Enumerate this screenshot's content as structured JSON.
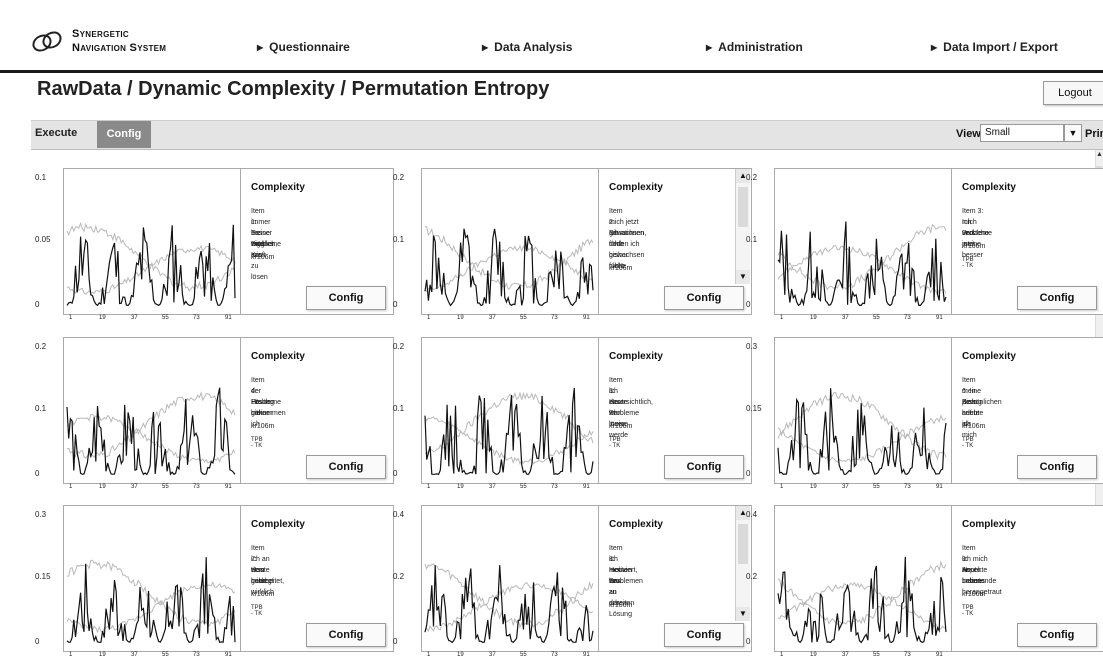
{
  "app": {
    "logo_line1": "Synergetic",
    "logo_line2": "Navigation System"
  },
  "nav": [
    {
      "label": "Questionnaire"
    },
    {
      "label": "Data Analysis"
    },
    {
      "label": "Administration"
    },
    {
      "label": "Data Import / Export"
    }
  ],
  "page_title": "RawData / Dynamic Complexity / Permutation Entropy",
  "logout_label": "Logout",
  "tabs": {
    "execute": "Execute",
    "config": "Config"
  },
  "view": {
    "label": "View",
    "selected": "Small",
    "print_label": "Prin"
  },
  "colors": {
    "accent_tab": "#8a8a8a",
    "line_dark": "#111111",
    "line_light": "#b9b9b9"
  },
  "icons": {
    "logo": "logo-icon",
    "nav_arrow": "triangle-right-icon",
    "dropdown": "chevron-down-icon"
  },
  "panels": [
    {
      "ymax": "0.1",
      "ymid": "0.05",
      "ymin": "0",
      "xticks": [
        "1",
        "19",
        "37",
        "55",
        "73",
        "91"
      ],
      "title": "Complexity",
      "item_lines": [
        "Item 1:   Es wird mir",
        "immer besser möglich,",
        "meine Probleme aus",
        "eigener Kraft zu lösen"
      ],
      "code": "kr106m",
      "tpb": "",
      "button": "Config"
    },
    {
      "ymax": "0.2",
      "ymid": "0.1",
      "ymin": "0",
      "xticks": [
        "1",
        "19",
        "37",
        "55",
        "73",
        "91"
      ],
      "title": "Complexity",
      "item_lines": [
        "Item 2:   Ich fühle",
        "mich jetzt Situationen",
        "gewachsen, denen ich",
        "mich bisher nicht",
        "gewachsen fühlte"
      ],
      "code": "kr106m",
      "tpb": "",
      "button": "Config"
    },
    {
      "ymax": "0.2",
      "ymid": "0.1",
      "ymin": "0",
      "xticks": [
        "1",
        "19",
        "37",
        "55",
        "73",
        "91"
      ],
      "title": "Complexity",
      "item_lines": [
        "Item 3:   Ich verstehe",
        "mich und meine",
        "Probleme jetzt besser"
      ],
      "code": "kr106m",
      "tpb": "TPB - TK",
      "button": "Config"
    },
    {
      "ymax": "0.2",
      "ymid": "0.1",
      "ymin": "0",
      "xticks": [
        "1",
        "19",
        "37",
        "55",
        "73",
        "91"
      ],
      "title": "Complexity",
      "item_lines": [
        "Item 4:   Heute bin ich",
        "der Lösung meiner",
        "Probleme näher",
        "gekommen"
      ],
      "code": "kr106m",
      "tpb": "TPB - TK",
      "button": "Config"
    },
    {
      "ymax": "0.2",
      "ymid": "0.1",
      "ymin": "0",
      "xticks": [
        "1",
        "19",
        "37",
        "55",
        "73",
        "91"
      ],
      "title": "Complexity",
      "item_lines": [
        "Item 5:   Heute war",
        "ich zuversichtlich,",
        "dass ich meine",
        "Probleme lösen werde"
      ],
      "code": "kr106m",
      "tpb": "TPB - TK",
      "button": "Config"
    },
    {
      "ymax": "0.3",
      "ymid": "0.15",
      "ymin": "0",
      "xticks": [
        "1",
        "19",
        "37",
        "55",
        "73",
        "91"
      ],
      "title": "Complexity",
      "item_lines": [
        "Item 6:   In Bezug auf",
        "meine persönlichen",
        "Ziele erlebte ich mich",
        "heute als"
      ],
      "code": "kr106m",
      "tpb": "TPB - TK",
      "button": "Config"
    },
    {
      "ymax": "0.3",
      "ymid": "0.15",
      "ymin": "0",
      "xticks": [
        "1",
        "19",
        "37",
        "55",
        "73",
        "91"
      ],
      "title": "Complexity",
      "item_lines": [
        "Item 7:   Heute habe",
        "ich an dem gearbeitet,",
        "was mich wirklich",
        "bewegt"
      ],
      "code": "kr106m",
      "tpb": "TPB - TK",
      "button": "Config"
    },
    {
      "ymax": "0.4",
      "ymid": "0.2",
      "ymin": "0",
      "xticks": [
        "1",
        "19",
        "37",
        "55",
        "73",
        "91"
      ],
      "title": "Complexity",
      "item_lines": [
        "Item 8:   Heute war",
        "ich motiviert, an",
        "meinen Problemen",
        "bzw. an deren Lösung",
        "zu arbeiten"
      ],
      "code": "kr106m",
      "tpb": "",
      "button": "Config"
    },
    {
      "ymax": "0.4",
      "ymid": "0.2",
      "ymin": "0",
      "xticks": [
        "1",
        "19",
        "37",
        "55",
        "73",
        "91"
      ],
      "title": "Complexity",
      "item_lines": [
        "Item 9:   Heute habe",
        "ich mich an belastende",
        "Aspekte meines",
        "Lebens herangetraut"
      ],
      "code": "kr106m",
      "tpb": "TPB - TK",
      "button": "Config"
    }
  ]
}
